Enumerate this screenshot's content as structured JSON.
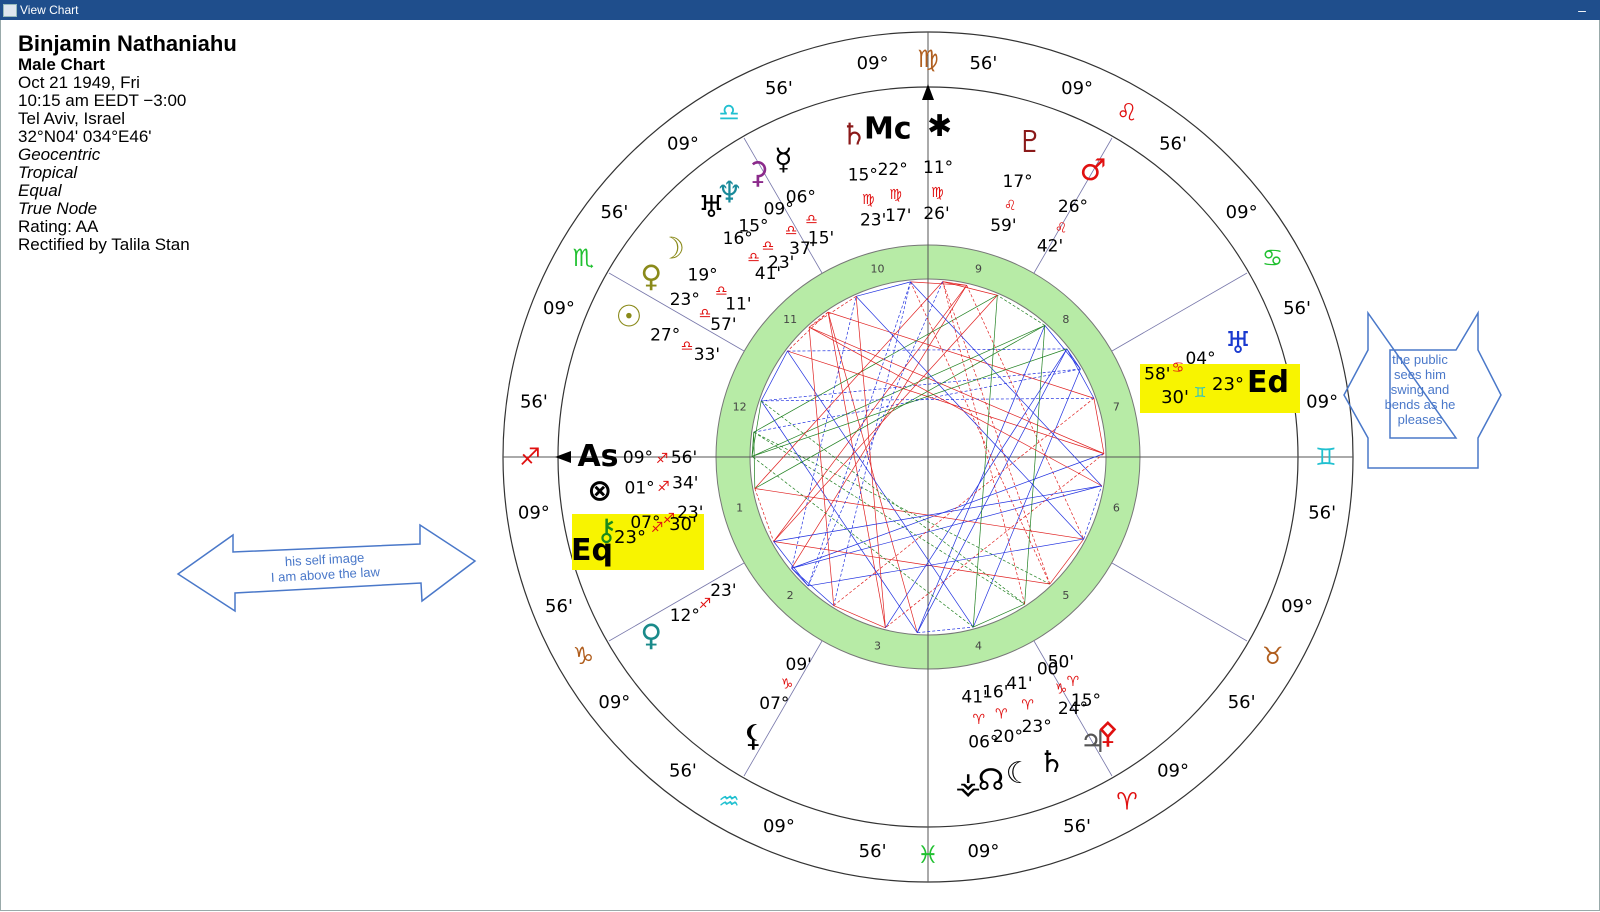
{
  "window": {
    "title": "View Chart",
    "minimize_glyph": "–"
  },
  "person": {
    "name": "Binjamin Nathaniahu",
    "chart_type": "Male Chart",
    "date": "Oct 21 1949, Fri",
    "time": "10:15 am  EEDT −3:00",
    "place": "Tel Aviv, Israel",
    "coords": "32°N04' 034°E46'",
    "options": [
      "Geocentric",
      "Tropical",
      "Equal",
      "True Node"
    ],
    "rating": "Rating: AA",
    "rectified": "Rectified by Talila Stan"
  },
  "annotations": {
    "public_lines": [
      "the public",
      "sees him",
      "swing and",
      "bends  as he",
      "pleases"
    ],
    "self_lines": [
      "his self image",
      "I am above the law"
    ]
  },
  "colors": {
    "highlight": "#f8f400",
    "house_ring": "#b7eba6",
    "fire": "#e01010",
    "earth": "#b05e1e",
    "air": "#20c0d0",
    "water": "#20c030",
    "aspect_red": "#e02020",
    "aspect_blue": "#2030e0",
    "aspect_green": "#208020",
    "arrow": "#4a78c9"
  },
  "zodiac_cusps": [
    {
      "sign": "♍",
      "deg": "09°",
      "min": "56'",
      "color": "#b05e1e"
    },
    {
      "sign": "♌",
      "deg": "09°",
      "min": "56'",
      "color": "#e01010"
    },
    {
      "sign": "♋",
      "deg": "09°",
      "min": "56'",
      "color": "#20c030"
    },
    {
      "sign": "♊",
      "deg": "09°",
      "min": "56'",
      "color": "#20c0d0"
    },
    {
      "sign": "♉",
      "deg": "09°",
      "min": "56'",
      "color": "#b05e1e"
    },
    {
      "sign": "♈",
      "deg": "09°",
      "min": "56'",
      "color": "#e01010"
    },
    {
      "sign": "♓",
      "deg": "09°",
      "min": "56'",
      "color": "#20c030"
    },
    {
      "sign": "♒",
      "deg": "09°",
      "min": "56'",
      "color": "#20c0d0"
    },
    {
      "sign": "♑",
      "deg": "09°",
      "min": "56'",
      "color": "#b05e1e"
    },
    {
      "sign": "♐",
      "deg": "09°",
      "min": "56'",
      "color": "#e01010"
    },
    {
      "sign": "♏",
      "deg": "09°",
      "min": "56'",
      "color": "#20c030"
    },
    {
      "sign": "♎",
      "deg": "09°",
      "min": "56'",
      "color": "#20c0d0"
    }
  ],
  "house_numbers": [
    "1",
    "2",
    "3",
    "4",
    "5",
    "6",
    "7",
    "8",
    "9",
    "10",
    "11",
    "12"
  ],
  "planets": [
    {
      "glyph": "Mc",
      "name": "midheaven",
      "deg": "22°",
      "sign": "♍",
      "min": "17'",
      "color": "#000000"
    },
    {
      "glyph": "♄",
      "name": "saturn",
      "deg": "15°",
      "sign": "♍",
      "min": "23'",
      "color": "#8b1a1a"
    },
    {
      "glyph": "✱",
      "name": "vertex",
      "deg": "11°",
      "sign": "♍",
      "min": "26'",
      "color": "#000000"
    },
    {
      "glyph": "☿",
      "name": "mercury",
      "deg": "06°",
      "sign": "♎",
      "min": "15'",
      "color": "#000000"
    },
    {
      "glyph": "⚳",
      "name": "ceres",
      "deg": "09°",
      "sign": "♎",
      "min": "37'",
      "color": "#8b2a8b"
    },
    {
      "glyph": "♆",
      "name": "neptune",
      "deg": "15°",
      "sign": "♎",
      "min": "23'",
      "color": "#1a8a9a"
    },
    {
      "glyph": "♅",
      "name": "uranus-symbol",
      "deg": "16°",
      "sign": "♎",
      "min": "41'",
      "color": "#000000"
    },
    {
      "glyph": "☽",
      "name": "moon",
      "deg": "19°",
      "sign": "♎",
      "min": "11'",
      "color": "#8a8a1a"
    },
    {
      "glyph": "♀",
      "name": "pallas",
      "deg": "23°",
      "sign": "♎",
      "min": "57'",
      "color": "#8a8a1a"
    },
    {
      "glyph": "☉",
      "name": "sun",
      "deg": "27°",
      "sign": "♎",
      "min": "33'",
      "color": "#8a8a1a"
    },
    {
      "glyph": "♂",
      "name": "mars",
      "deg": "26°",
      "sign": "♌",
      "min": "42'",
      "color": "#e01010"
    },
    {
      "glyph": "♇",
      "name": "pluto",
      "deg": "17°",
      "sign": "♌",
      "min": "59'",
      "color": "#8b1a1a"
    },
    {
      "glyph": "♅",
      "name": "uranus",
      "deg": "04°",
      "sign": "♋",
      "min": "58'",
      "color": "#1a3ad0"
    },
    {
      "glyph": "⊗",
      "name": "part-of-fortune",
      "deg": "01°",
      "sign": "♐",
      "min": "34'",
      "color": "#000000"
    },
    {
      "glyph": "⚷",
      "name": "chiron",
      "deg": "07°",
      "sign": "♐",
      "min": "23'",
      "color": "#1a8a1a"
    },
    {
      "glyph": "As",
      "name": "ascendant",
      "deg": "09°",
      "sign": "♐",
      "min": "56'",
      "color": "#000000"
    },
    {
      "glyph": "♀",
      "name": "venus",
      "deg": "12°",
      "sign": "♐",
      "min": "23'",
      "color": "#1a8a8a"
    },
    {
      "glyph": "⚸",
      "name": "lilith",
      "deg": "07°",
      "sign": "♑",
      "min": "09'",
      "color": "#000000"
    },
    {
      "glyph": "♃",
      "name": "jupiter",
      "deg": "24°",
      "sign": "♑",
      "min": "00'",
      "color": "#555555"
    },
    {
      "glyph": "⚴",
      "name": "juno",
      "deg": "15°",
      "sign": "♈",
      "min": "50'",
      "color": "#e01010"
    },
    {
      "glyph": "♄",
      "name": "saturn-symbol",
      "deg": "23°",
      "sign": "♈",
      "min": "41'",
      "color": "#000000"
    },
    {
      "glyph": "☾",
      "name": "black-moon",
      "deg": "20°",
      "sign": "♈",
      "min": "16'",
      "color": "#000000"
    },
    {
      "glyph": "☊",
      "name": "north-node",
      "deg": "06°",
      "sign": "♈",
      "min": "41'",
      "color": "#000000"
    },
    {
      "glyph": "⚶",
      "name": "vesta",
      "deg": "",
      "sign": "",
      "min": "",
      "color": "#000000"
    }
  ],
  "eq_east": {
    "glyph": "Ed",
    "deg": "23°",
    "sign": "♊",
    "min": "30'"
  },
  "eq_west": {
    "glyph": "Eq",
    "deg": "23°",
    "sign": "♐",
    "min": "30'"
  }
}
